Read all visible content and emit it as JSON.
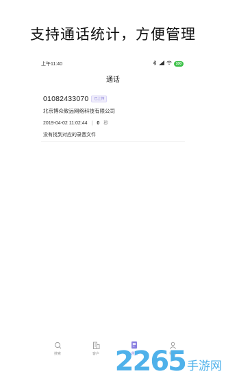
{
  "promo": {
    "title": "支持通话统计，方便管理"
  },
  "status_bar": {
    "time": "上午11:40",
    "battery": "100"
  },
  "header": {
    "title": "通话"
  },
  "call_record": {
    "phone": "01082433070",
    "badge": "已上传",
    "company": "北京博众致远网络科技有限公司",
    "datetime": "2019-04-02 11:02:44",
    "separator": "|",
    "duration": "0",
    "duration_unit": "秒",
    "recording_status": "没有找到对应的录音文件"
  },
  "tabs": [
    {
      "label": "搜索",
      "icon": "search-icon",
      "active": false
    },
    {
      "label": "客户",
      "icon": "building-icon",
      "active": false
    },
    {
      "label": "通话",
      "icon": "call-record-icon",
      "active": true
    },
    {
      "label": "我的",
      "icon": "user-icon",
      "active": false
    }
  ],
  "watermark": {
    "logo": "2265",
    "text": "手游网"
  },
  "colors": {
    "accent": "#8a7fe0",
    "battery": "#3ec24a",
    "watermark": "#4fb1ea"
  }
}
